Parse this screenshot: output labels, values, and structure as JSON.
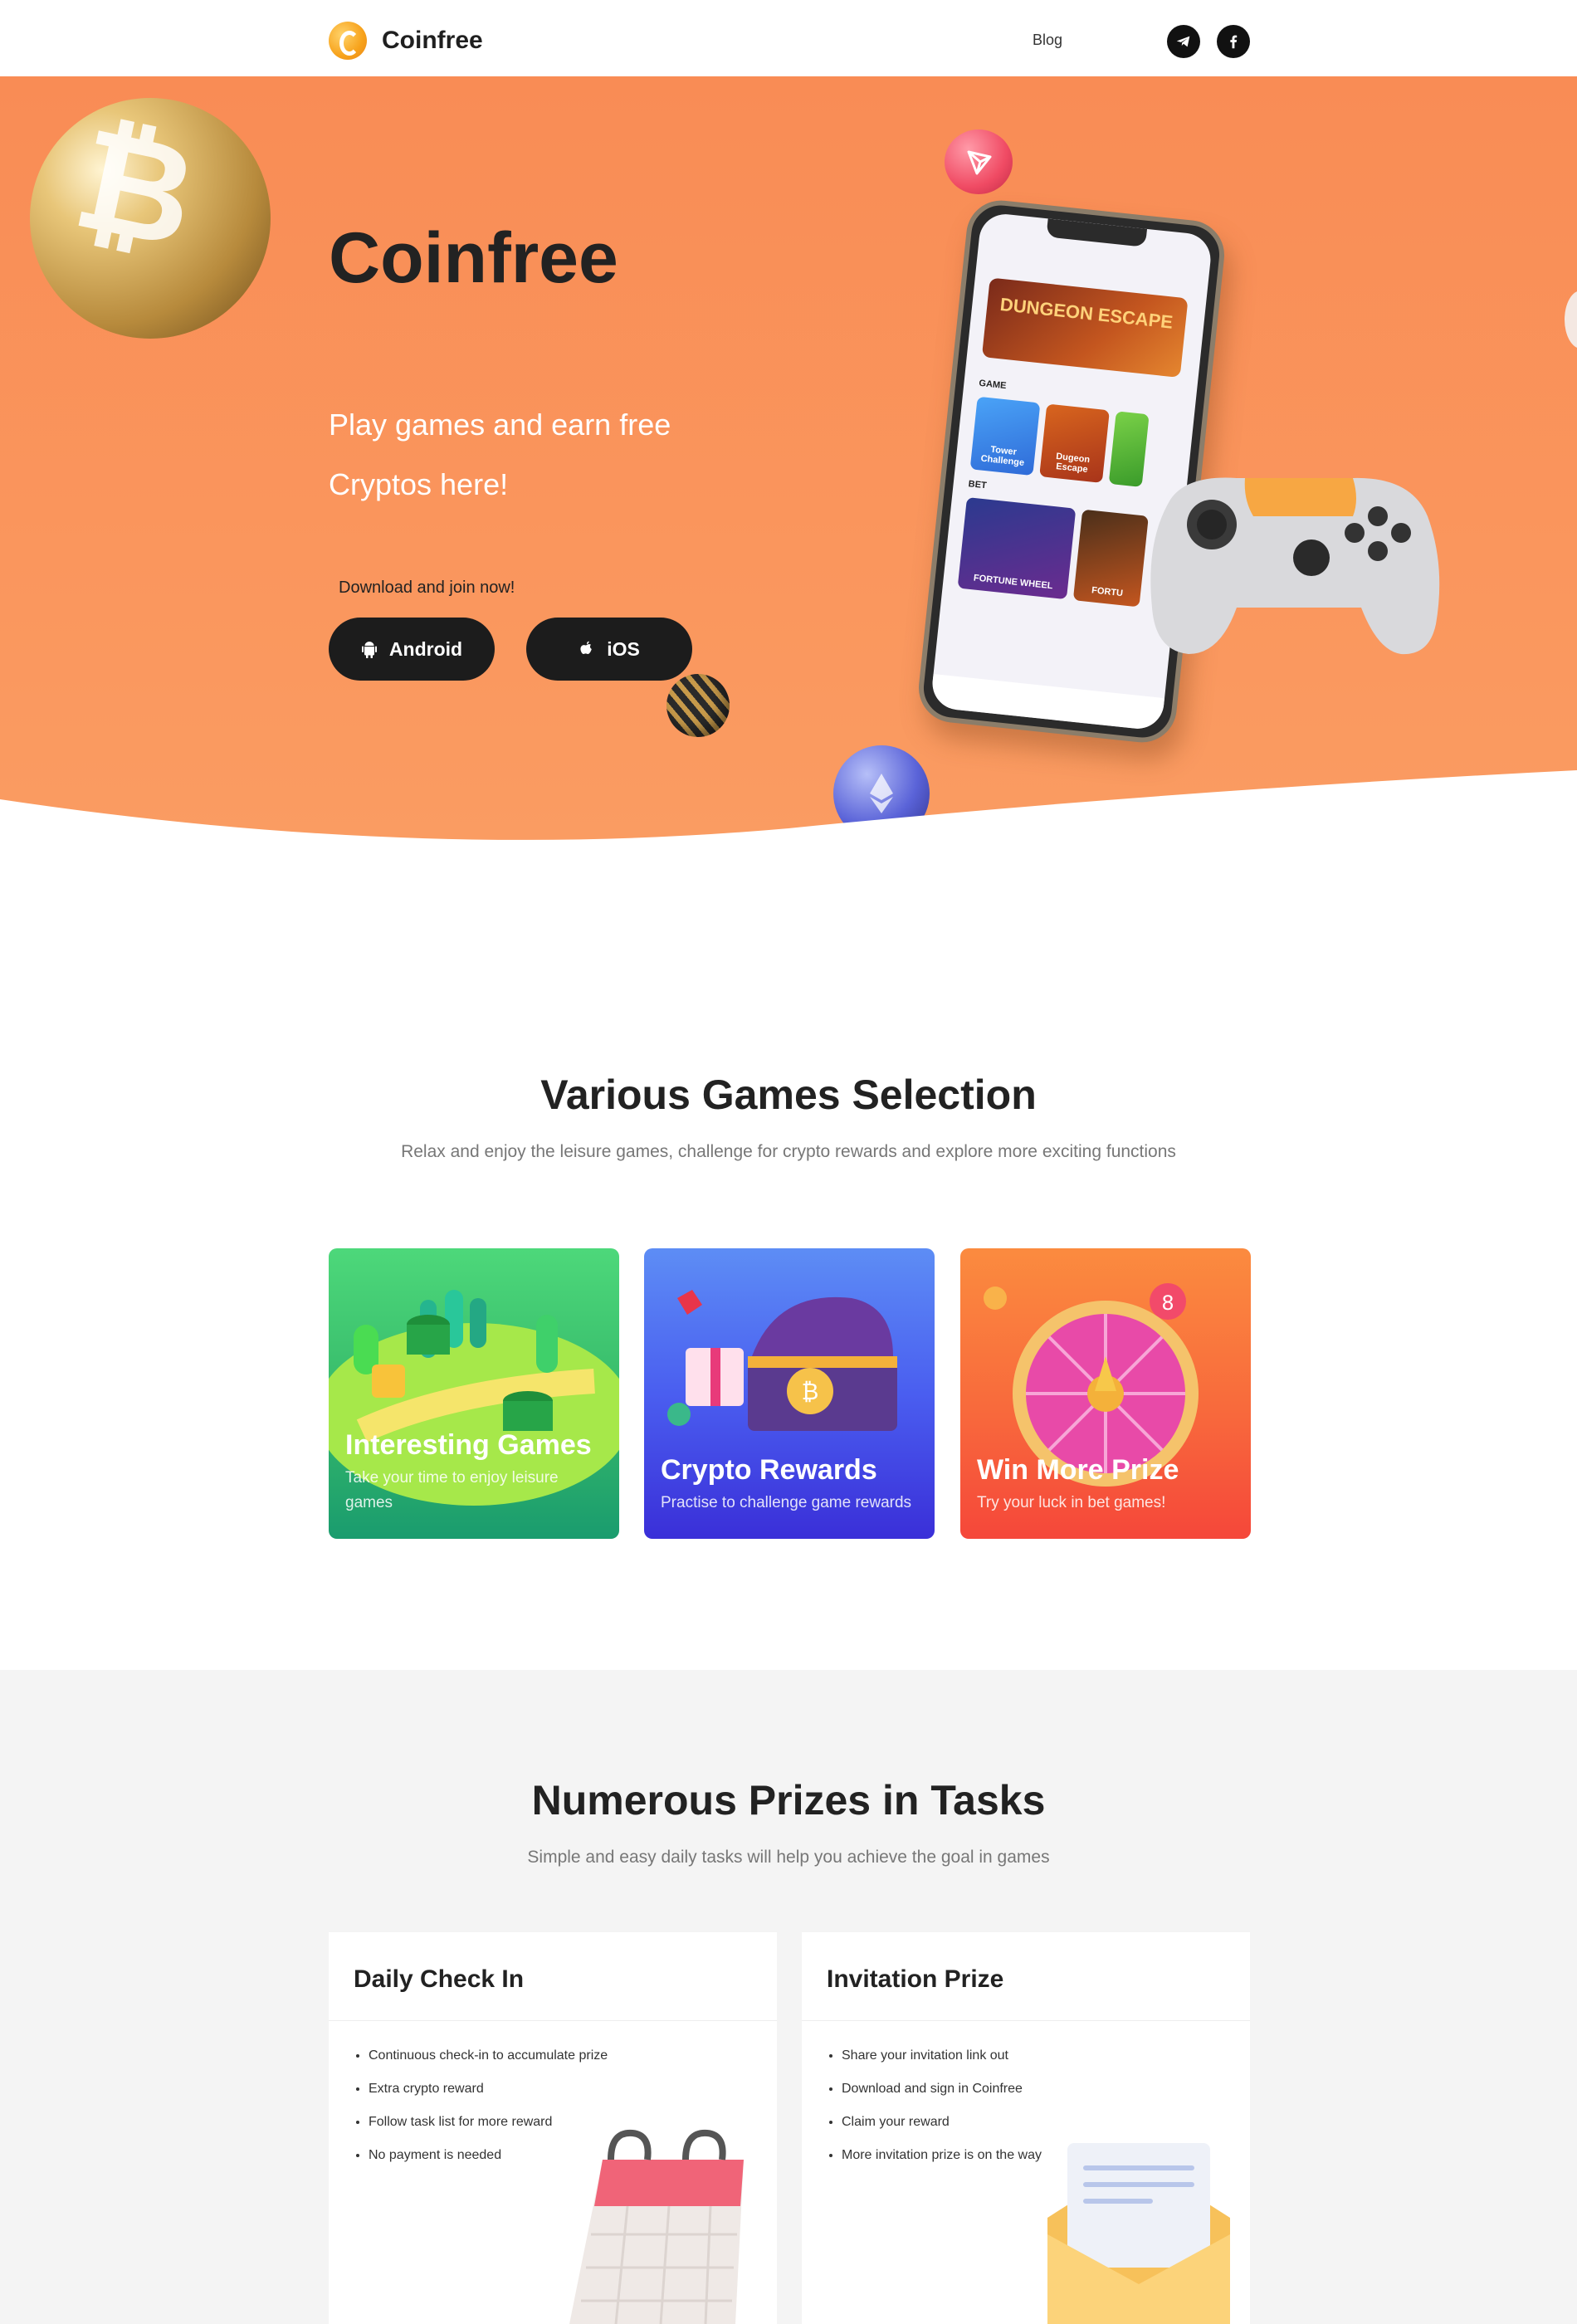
{
  "header": {
    "brand": "Coinfree",
    "nav_blog": "Blog",
    "social": [
      "telegram-icon",
      "facebook-icon"
    ]
  },
  "hero": {
    "title": "Coinfree",
    "subtitle": "Play games and earn free Cryptos here!",
    "cta": "Download and join now!",
    "android_label": "Android",
    "ios_label": "iOS",
    "phone": {
      "banner": "DUNGEON ESCAPE",
      "section_game": "GAME",
      "tiles": [
        "Tower Challenge",
        "Dugeon Escape"
      ],
      "section_bet": "BET",
      "bet_tile": "FORTUNE WHEEL",
      "bet_tile_2": "FORTU"
    }
  },
  "games": {
    "title": "Various Games Selection",
    "subtitle": "Relax and enjoy the leisure games, challenge for crypto rewards and explore more exciting functions",
    "cards": [
      {
        "title": "Interesting Games",
        "desc": "Take your time to enjoy leisure games"
      },
      {
        "title": "Crypto Rewards",
        "desc": "Practise to challenge game rewards"
      },
      {
        "title": "Win More Prize",
        "desc": "Try your luck in bet games!"
      }
    ]
  },
  "tasks": {
    "title": "Numerous Prizes in Tasks",
    "subtitle": "Simple and easy daily tasks will help you achieve the goal in games",
    "cards": [
      {
        "title": "Daily Check In",
        "items": [
          "Continuous check-in to accumulate prize",
          "Extra crypto reward",
          "Follow task list for more reward",
          "No payment is needed"
        ]
      },
      {
        "title": "Invitation Prize",
        "items": [
          "Share your invitation link out",
          "Download and sign in Coinfree",
          "Claim your reward",
          "More invitation prize is on the way"
        ]
      }
    ]
  },
  "colors": {
    "hero": "#f98c55",
    "dark_button": "#1c1c1c",
    "card_green": "#2fb97a",
    "card_blue": "#4a4ff0",
    "card_orange": "#fa6a40",
    "section_gray": "#f4f4f4"
  }
}
